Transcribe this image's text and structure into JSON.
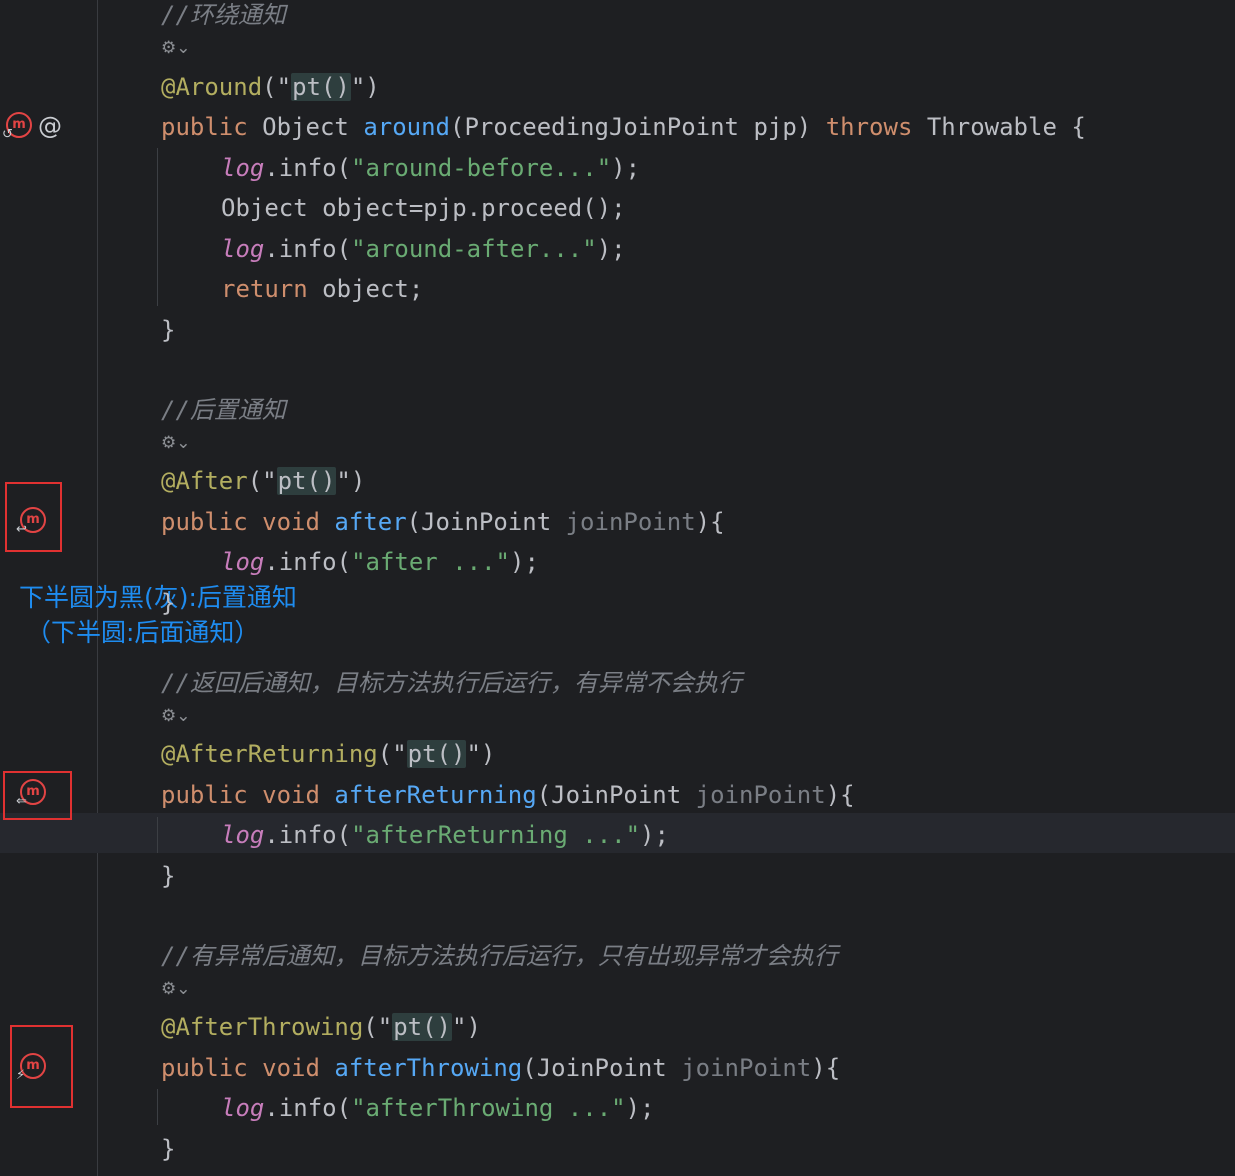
{
  "gutter": {
    "at_sign": "@",
    "method_glyph": "m",
    "around_arrow": "↺",
    "after_arrow": "↩",
    "returning_arrow": "⇐",
    "throwing_arrow": "⚡",
    "inspection_glyph": "⚙⌄"
  },
  "annotation_note": {
    "line1": "下半圆为黑(灰):后置通知",
    "line2": "（下半圆:后面通知）"
  },
  "code": {
    "around": {
      "comment": "//环绕通知",
      "annotation": "@Around",
      "paren_open": "(\"",
      "arg": "pt()",
      "paren_close": "\")",
      "sig_public": "public",
      "sig_type": "Object",
      "sig_name": "around",
      "sig_params": "(ProceedingJoinPoint pjp)",
      "sig_throws": "throws",
      "sig_exc": "Throwable {",
      "body": [
        {
          "log": "log",
          "call": ".info(",
          "str": "\"around-before...\"",
          "end": ");"
        },
        {
          "plain": "Object object=pjp.proceed();"
        },
        {
          "log": "log",
          "call": ".info(",
          "str": "\"around-after...\"",
          "end": ");"
        }
      ],
      "ret_kw": "return",
      "ret_rest": " object;",
      "close": "}"
    },
    "after": {
      "comment": "//后置通知",
      "annotation": "@After",
      "paren_open": "(\"",
      "arg": "pt()",
      "paren_close": "\")",
      "sig_public": "public",
      "sig_void": "void",
      "sig_name": "after",
      "sig_type": "(JoinPoint ",
      "sig_param": "joinPoint",
      "sig_end": "){",
      "log": "log",
      "call": ".info(",
      "str": "\"after ...\"",
      "end": ");",
      "close": "}"
    },
    "returning": {
      "comment": "//返回后通知，目标方法执行后运行，有异常不会执行",
      "annotation": "@AfterReturning",
      "paren_open": "(\"",
      "arg": "pt()",
      "paren_close": "\")",
      "sig_public": "public",
      "sig_void": "void",
      "sig_name": "afterReturning",
      "sig_type": "(JoinPoint ",
      "sig_param": "joinPoint",
      "sig_end": "){",
      "log": "log",
      "call": ".info(",
      "str": "\"afterReturning ...\"",
      "end": ");",
      "close": "}"
    },
    "throwing": {
      "comment": "//有异常后通知，目标方法执行后运行，只有出现异常才会执行",
      "annotation": "@AfterThrowing",
      "paren_open": "(\"",
      "arg": "pt()",
      "paren_close": "\")",
      "sig_public": "public",
      "sig_void": "void",
      "sig_name": "afterThrowing",
      "sig_type": "(JoinPoint ",
      "sig_param": "joinPoint",
      "sig_end": "){",
      "log": "log",
      "call": ".info(",
      "str": "\"afterThrowing ...\"",
      "end": ");",
      "close": "}"
    }
  }
}
